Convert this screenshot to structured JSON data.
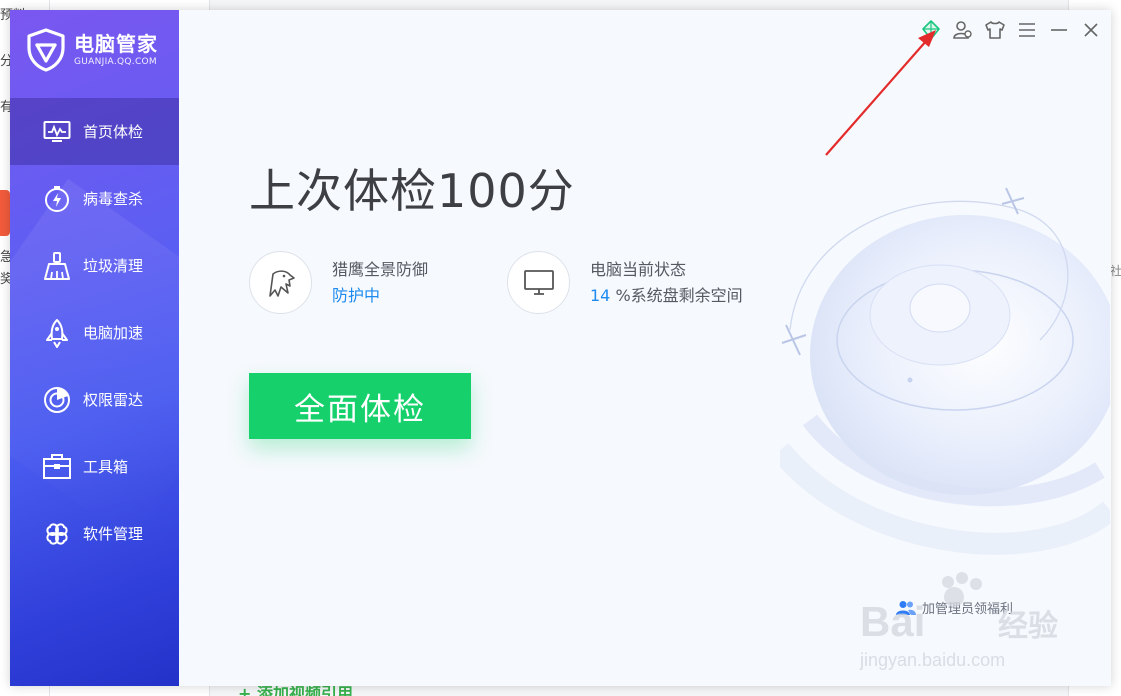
{
  "background": {
    "left_fragments": [
      "预料",
      "分享",
      "有项",
      "急",
      "奖"
    ],
    "right_fragment": "社天",
    "bottom_link": "+ 添加视频引用"
  },
  "app": {
    "name": "电脑管家",
    "domain": "GUANJIA.QQ.COM",
    "brand_color": "#5a5ef2",
    "accent_green": "#15d06b"
  },
  "sidebar": {
    "items": [
      {
        "label": "首页体检",
        "icon": "monitor-pulse-icon",
        "active": true
      },
      {
        "label": "病毒查杀",
        "icon": "lightning-circle-icon"
      },
      {
        "label": "垃圾清理",
        "icon": "broom-icon"
      },
      {
        "label": "电脑加速",
        "icon": "rocket-icon"
      },
      {
        "label": "权限雷达",
        "icon": "radar-icon"
      },
      {
        "label": "工具箱",
        "icon": "toolbox-icon"
      },
      {
        "label": "软件管理",
        "icon": "clover-icon"
      }
    ]
  },
  "titlebar": {
    "icons": [
      "diamond-icon",
      "user-settings-icon",
      "skin-icon",
      "menu-icon",
      "minimize-icon",
      "close-icon"
    ]
  },
  "main": {
    "headline": "上次体检100分",
    "protection": {
      "title": "猎鹰全景防御",
      "status": "防护中",
      "icon": "eagle-icon"
    },
    "pc_status": {
      "title": "电脑当前状态",
      "value": "14",
      "unit": "%系统盘剩余空间",
      "icon": "monitor-icon"
    },
    "scan_button": "全面体检",
    "promo_text": "加管理员领福利"
  },
  "watermark": {
    "brand": "Baidu 经验",
    "url": "jingyan.baidu.com"
  }
}
